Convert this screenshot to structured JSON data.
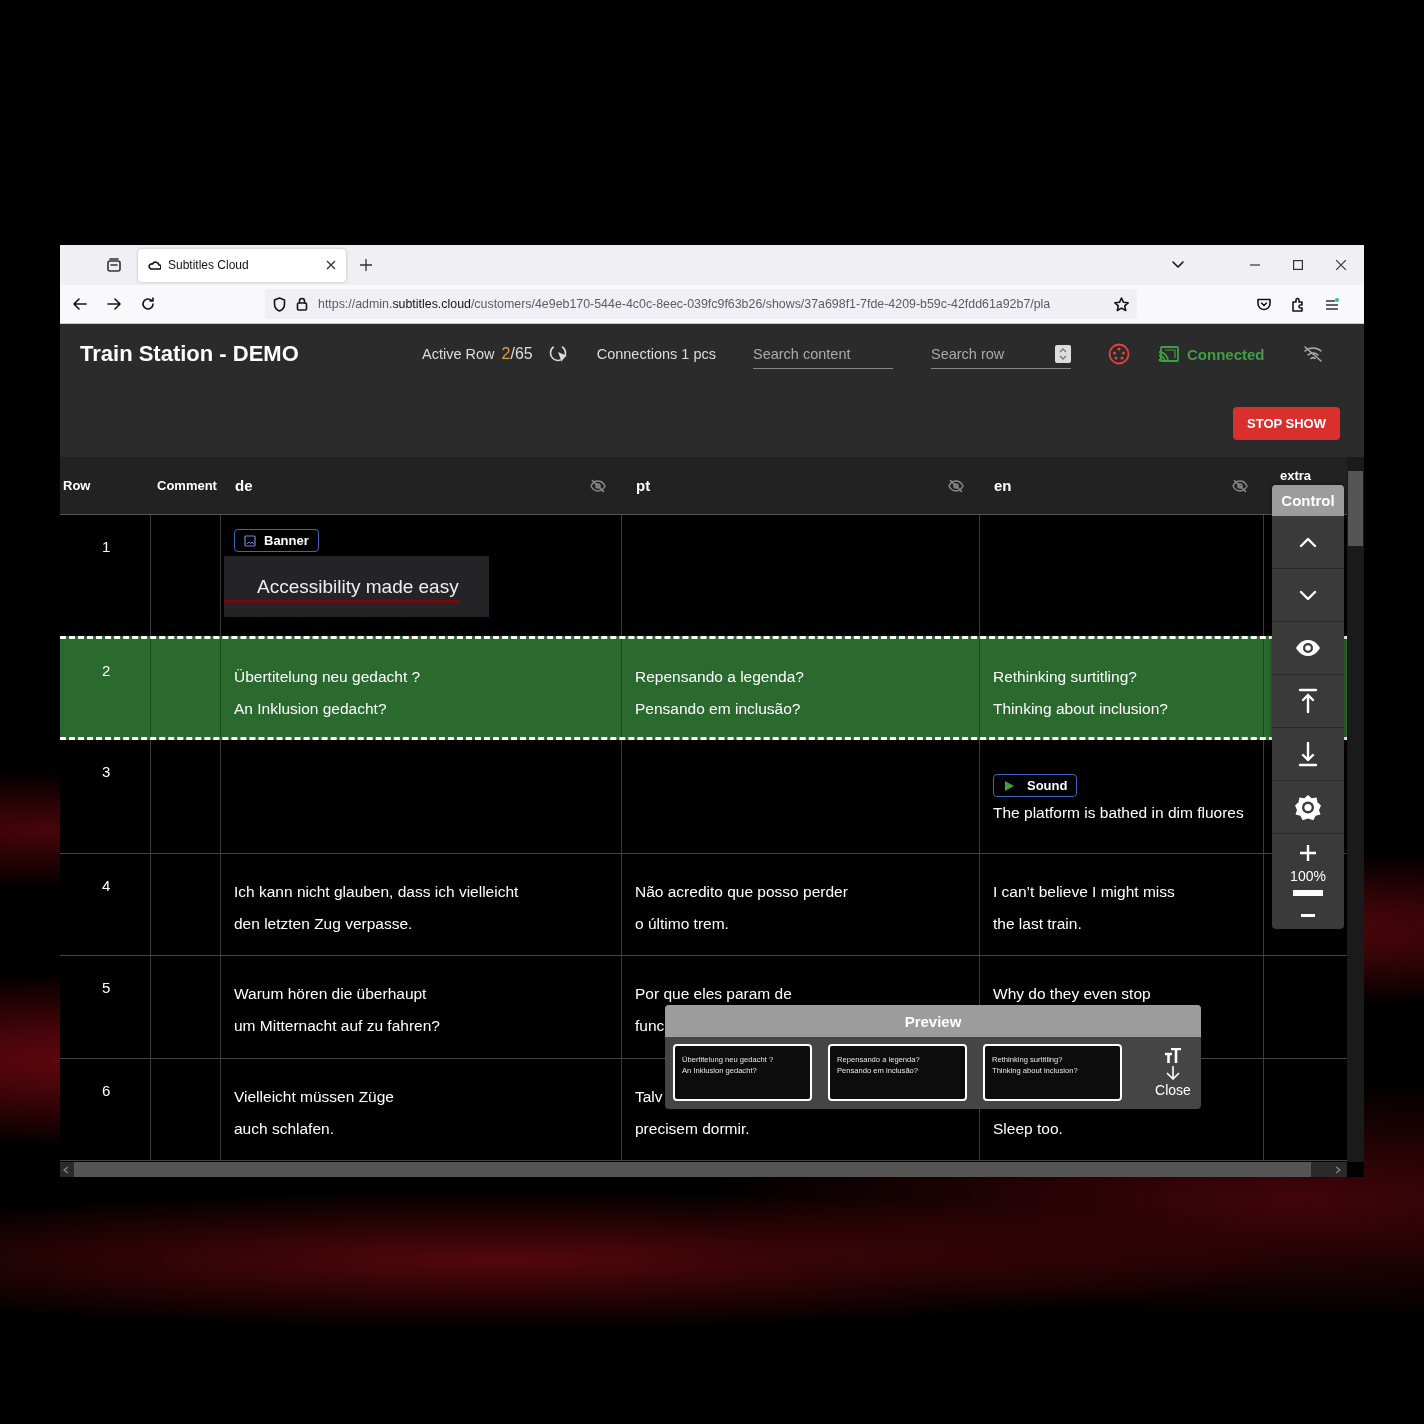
{
  "browser": {
    "tab_title": "Subtitles Cloud",
    "url": "https://admin.**subtitles.cloud**/customers/4e9eb170-544e-4c0c-8eec-039fc9f63b26/shows/37a698f1-7fde-4209-b59c-42fdd61a92b7/pla"
  },
  "header": {
    "title": "Train Station - DEMO",
    "active_row_label": "Active Row",
    "active_row_current": "2",
    "active_row_total": "/65",
    "connections": "Connections 1 pcs",
    "search_content": {
      "placeholder": "Search content"
    },
    "search_row": {
      "placeholder": "Search row"
    },
    "connection_status": "Connected",
    "stop_button": "STOP SHOW"
  },
  "table": {
    "columns": [
      {
        "label": "Row",
        "kind": "meta"
      },
      {
        "label": "Comment",
        "kind": "meta"
      },
      {
        "label": "de",
        "kind": "language"
      },
      {
        "label": "pt",
        "kind": "language"
      },
      {
        "label": "en",
        "kind": "language"
      },
      {
        "label": "extra",
        "kind": "meta"
      }
    ],
    "rows": [
      {
        "selected": false,
        "cells": [
          "1",
          "",
          {
            "tag": {
              "kind": "banner",
              "label": "Banner"
            },
            "banner_text": "Accessibility made easy"
          },
          "",
          "",
          ""
        ]
      },
      {
        "selected": true,
        "cells": [
          "2",
          "",
          {
            "lines": [
              "Übertitelung neu gedacht ?",
              "An Inklusion gedacht?"
            ]
          },
          {
            "lines": [
              "Repensando a legenda?",
              "Pensando em inclusão?"
            ]
          },
          {
            "lines": [
              "Rethinking surtitling?",
              "Thinking about inclusion?"
            ]
          },
          ""
        ]
      },
      {
        "selected": false,
        "cells": [
          "3",
          "",
          "",
          "",
          {
            "tag": {
              "kind": "sound",
              "label": "Sound"
            },
            "lines": [
              "The platform is bathed in dim fluores"
            ]
          },
          ""
        ]
      },
      {
        "selected": false,
        "cells": [
          "4",
          "",
          {
            "lines": [
              "Ich kann nicht glauben, dass ich vielleicht",
              "den letzten Zug verpasse."
            ]
          },
          {
            "lines": [
              "Não acredito que posso perder",
              "o último trem."
            ]
          },
          {
            "lines": [
              "I can’t believe I might miss",
              "the last train."
            ]
          },
          ""
        ]
      },
      {
        "selected": false,
        "cells": [
          "5",
          "",
          {
            "lines": [
              "Warum hören die überhaupt",
              "um Mitternacht auf zu fahren?"
            ]
          },
          {
            "lines": [
              "Por que eles param de",
              "func"
            ]
          },
          {
            "lines": [
              "Why do they even stop"
            ]
          },
          ""
        ]
      },
      {
        "selected": false,
        "cells": [
          "6",
          "",
          {
            "lines": [
              "Vielleicht müssen Züge",
              "auch schlafen."
            ]
          },
          {
            "lines": [
              "Talv",
              "precisem dormir."
            ]
          },
          {
            "first_line_covered": true,
            "lines": [
              "Sleep too."
            ]
          },
          ""
        ]
      }
    ]
  },
  "control_panel": {
    "title": "Control",
    "zoom": "100%"
  },
  "preview": {
    "title": "Preview",
    "cards": [
      {
        "lines": [
          "Übertitelung neu gedacht ?",
          "An Inklusion gedacht?"
        ]
      },
      {
        "lines": [
          "Repensando a legenda?",
          "Pensando em inclusão?"
        ]
      },
      {
        "lines": [
          "Rethinking surtitling?",
          "Thinking about inclusion?"
        ]
      }
    ],
    "close": "Close"
  }
}
